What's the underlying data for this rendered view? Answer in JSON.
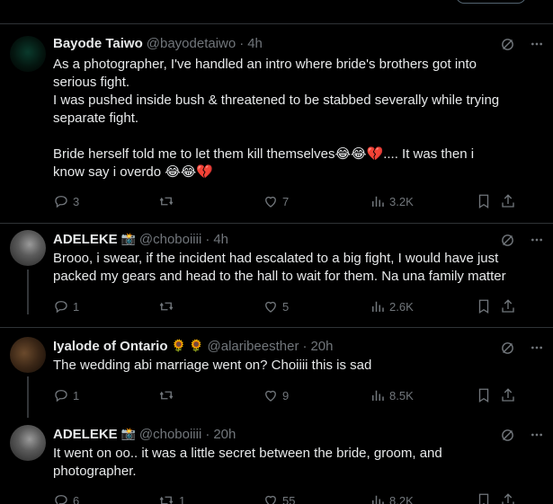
{
  "tweets": [
    {
      "name": "Bayode Taiwo",
      "handle": "@bayodetaiwo",
      "time": "4h",
      "badge": "",
      "text": "As a photographer, I've handled an intro where bride's brothers got into serious fight.\nI was pushed inside bush & threatened to be stabbed severally while trying separate fight.\n\nBride herself told me to let them kill themselves😂😂💔.... It was then i know say i overdo 😂😂💔",
      "replies": "3",
      "retweets": "",
      "likes": "7",
      "views": "3.2K"
    },
    {
      "name": "ADELEKE",
      "handle": "@choboiiii",
      "time": "4h",
      "badge": "📸",
      "text": "Brooo, i swear, if the incident had escalated to a big fight, I would have just packed my gears and head to the hall to wait for them. Na una family matter",
      "replies": "1",
      "retweets": "",
      "likes": "5",
      "views": "2.6K"
    },
    {
      "name": "Iyalode of Ontario",
      "handle": "@alaribeesther",
      "time": "20h",
      "badge": "🌻 🌻",
      "text": "The wedding abi marriage went on? Choiiii this is sad",
      "replies": "1",
      "retweets": "",
      "likes": "9",
      "views": "8.5K"
    },
    {
      "name": "ADELEKE",
      "handle": "@choboiiii",
      "time": "20h",
      "badge": "📸",
      "text": "It went on oo.. it was a little secret between the bride, groom, and photographer.",
      "replies": "6",
      "retweets": "1",
      "likes": "55",
      "views": "8.2K"
    }
  ],
  "separator": "·",
  "icons": {
    "reply": "reply-icon",
    "retweet": "retweet-icon",
    "like": "heart-icon",
    "views": "views-icon",
    "bookmark": "bookmark-icon",
    "share": "share-icon",
    "grok": "grok-icon",
    "more": "more-icon"
  },
  "colors": {
    "background": "#000000",
    "text": "#e7e9ea",
    "muted": "#71767b",
    "border": "#2f3336"
  }
}
